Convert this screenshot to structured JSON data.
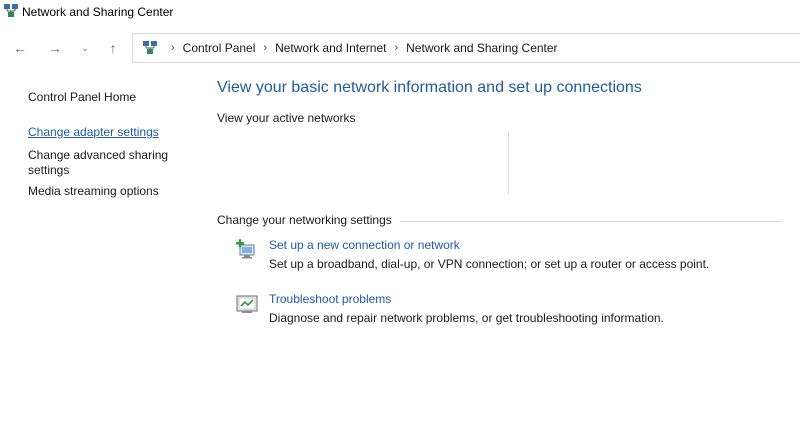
{
  "window": {
    "title": "Network and Sharing Center",
    "icon": "network-center-icon"
  },
  "nav": {
    "back": "←",
    "forward": "→",
    "recent": "⌄",
    "up": "↑"
  },
  "breadcrumb": {
    "items": [
      "Control Panel",
      "Network and Internet",
      "Network and Sharing Center"
    ],
    "separator": "›"
  },
  "left_pane": {
    "home": "Control Panel Home",
    "adapter": "Change adapter settings",
    "advanced": "Change advanced sharing settings",
    "media": "Media streaming options"
  },
  "main": {
    "title": "View your basic network information and set up connections",
    "active_networks_label": "View your active networks",
    "change_settings_label": "Change your networking settings",
    "tasks": [
      {
        "link": "Set up a new connection or network",
        "desc": "Set up a broadband, dial-up, or VPN connection; or set up a router or access point.",
        "icon": "new-connection-icon"
      },
      {
        "link": "Troubleshoot problems",
        "desc": "Diagnose and repair network problems, or get troubleshooting information.",
        "icon": "troubleshoot-icon"
      }
    ]
  },
  "colors": {
    "link": "#1e5ba8",
    "title": "#1e5b9a",
    "rule": "#d6d6d6"
  }
}
